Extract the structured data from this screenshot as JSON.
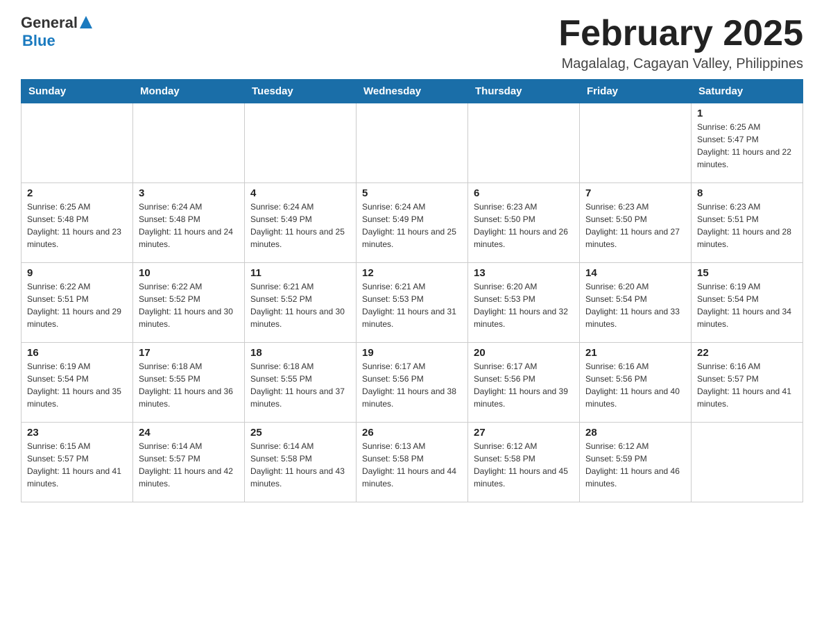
{
  "header": {
    "logo": {
      "text1": "General",
      "text2": "Blue"
    },
    "month_title": "February 2025",
    "location": "Magalalag, Cagayan Valley, Philippines"
  },
  "weekdays": [
    "Sunday",
    "Monday",
    "Tuesday",
    "Wednesday",
    "Thursday",
    "Friday",
    "Saturday"
  ],
  "weeks": [
    [
      {
        "day": "",
        "sunrise": "",
        "sunset": "",
        "daylight": ""
      },
      {
        "day": "",
        "sunrise": "",
        "sunset": "",
        "daylight": ""
      },
      {
        "day": "",
        "sunrise": "",
        "sunset": "",
        "daylight": ""
      },
      {
        "day": "",
        "sunrise": "",
        "sunset": "",
        "daylight": ""
      },
      {
        "day": "",
        "sunrise": "",
        "sunset": "",
        "daylight": ""
      },
      {
        "day": "",
        "sunrise": "",
        "sunset": "",
        "daylight": ""
      },
      {
        "day": "1",
        "sunrise": "Sunrise: 6:25 AM",
        "sunset": "Sunset: 5:47 PM",
        "daylight": "Daylight: 11 hours and 22 minutes."
      }
    ],
    [
      {
        "day": "2",
        "sunrise": "Sunrise: 6:25 AM",
        "sunset": "Sunset: 5:48 PM",
        "daylight": "Daylight: 11 hours and 23 minutes."
      },
      {
        "day": "3",
        "sunrise": "Sunrise: 6:24 AM",
        "sunset": "Sunset: 5:48 PM",
        "daylight": "Daylight: 11 hours and 24 minutes."
      },
      {
        "day": "4",
        "sunrise": "Sunrise: 6:24 AM",
        "sunset": "Sunset: 5:49 PM",
        "daylight": "Daylight: 11 hours and 25 minutes."
      },
      {
        "day": "5",
        "sunrise": "Sunrise: 6:24 AM",
        "sunset": "Sunset: 5:49 PM",
        "daylight": "Daylight: 11 hours and 25 minutes."
      },
      {
        "day": "6",
        "sunrise": "Sunrise: 6:23 AM",
        "sunset": "Sunset: 5:50 PM",
        "daylight": "Daylight: 11 hours and 26 minutes."
      },
      {
        "day": "7",
        "sunrise": "Sunrise: 6:23 AM",
        "sunset": "Sunset: 5:50 PM",
        "daylight": "Daylight: 11 hours and 27 minutes."
      },
      {
        "day": "8",
        "sunrise": "Sunrise: 6:23 AM",
        "sunset": "Sunset: 5:51 PM",
        "daylight": "Daylight: 11 hours and 28 minutes."
      }
    ],
    [
      {
        "day": "9",
        "sunrise": "Sunrise: 6:22 AM",
        "sunset": "Sunset: 5:51 PM",
        "daylight": "Daylight: 11 hours and 29 minutes."
      },
      {
        "day": "10",
        "sunrise": "Sunrise: 6:22 AM",
        "sunset": "Sunset: 5:52 PM",
        "daylight": "Daylight: 11 hours and 30 minutes."
      },
      {
        "day": "11",
        "sunrise": "Sunrise: 6:21 AM",
        "sunset": "Sunset: 5:52 PM",
        "daylight": "Daylight: 11 hours and 30 minutes."
      },
      {
        "day": "12",
        "sunrise": "Sunrise: 6:21 AM",
        "sunset": "Sunset: 5:53 PM",
        "daylight": "Daylight: 11 hours and 31 minutes."
      },
      {
        "day": "13",
        "sunrise": "Sunrise: 6:20 AM",
        "sunset": "Sunset: 5:53 PM",
        "daylight": "Daylight: 11 hours and 32 minutes."
      },
      {
        "day": "14",
        "sunrise": "Sunrise: 6:20 AM",
        "sunset": "Sunset: 5:54 PM",
        "daylight": "Daylight: 11 hours and 33 minutes."
      },
      {
        "day": "15",
        "sunrise": "Sunrise: 6:19 AM",
        "sunset": "Sunset: 5:54 PM",
        "daylight": "Daylight: 11 hours and 34 minutes."
      }
    ],
    [
      {
        "day": "16",
        "sunrise": "Sunrise: 6:19 AM",
        "sunset": "Sunset: 5:54 PM",
        "daylight": "Daylight: 11 hours and 35 minutes."
      },
      {
        "day": "17",
        "sunrise": "Sunrise: 6:18 AM",
        "sunset": "Sunset: 5:55 PM",
        "daylight": "Daylight: 11 hours and 36 minutes."
      },
      {
        "day": "18",
        "sunrise": "Sunrise: 6:18 AM",
        "sunset": "Sunset: 5:55 PM",
        "daylight": "Daylight: 11 hours and 37 minutes."
      },
      {
        "day": "19",
        "sunrise": "Sunrise: 6:17 AM",
        "sunset": "Sunset: 5:56 PM",
        "daylight": "Daylight: 11 hours and 38 minutes."
      },
      {
        "day": "20",
        "sunrise": "Sunrise: 6:17 AM",
        "sunset": "Sunset: 5:56 PM",
        "daylight": "Daylight: 11 hours and 39 minutes."
      },
      {
        "day": "21",
        "sunrise": "Sunrise: 6:16 AM",
        "sunset": "Sunset: 5:56 PM",
        "daylight": "Daylight: 11 hours and 40 minutes."
      },
      {
        "day": "22",
        "sunrise": "Sunrise: 6:16 AM",
        "sunset": "Sunset: 5:57 PM",
        "daylight": "Daylight: 11 hours and 41 minutes."
      }
    ],
    [
      {
        "day": "23",
        "sunrise": "Sunrise: 6:15 AM",
        "sunset": "Sunset: 5:57 PM",
        "daylight": "Daylight: 11 hours and 41 minutes."
      },
      {
        "day": "24",
        "sunrise": "Sunrise: 6:14 AM",
        "sunset": "Sunset: 5:57 PM",
        "daylight": "Daylight: 11 hours and 42 minutes."
      },
      {
        "day": "25",
        "sunrise": "Sunrise: 6:14 AM",
        "sunset": "Sunset: 5:58 PM",
        "daylight": "Daylight: 11 hours and 43 minutes."
      },
      {
        "day": "26",
        "sunrise": "Sunrise: 6:13 AM",
        "sunset": "Sunset: 5:58 PM",
        "daylight": "Daylight: 11 hours and 44 minutes."
      },
      {
        "day": "27",
        "sunrise": "Sunrise: 6:12 AM",
        "sunset": "Sunset: 5:58 PM",
        "daylight": "Daylight: 11 hours and 45 minutes."
      },
      {
        "day": "28",
        "sunrise": "Sunrise: 6:12 AM",
        "sunset": "Sunset: 5:59 PM",
        "daylight": "Daylight: 11 hours and 46 minutes."
      },
      {
        "day": "",
        "sunrise": "",
        "sunset": "",
        "daylight": ""
      }
    ]
  ]
}
